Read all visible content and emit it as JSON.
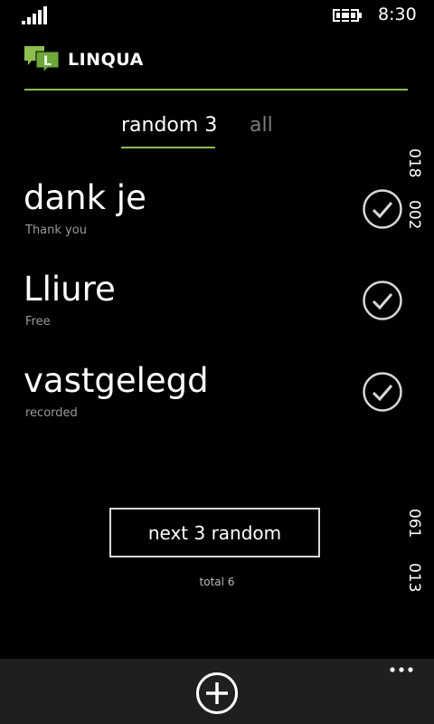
{
  "status": {
    "time": "8:30"
  },
  "app": {
    "title": "LINQUA",
    "logo_letter": "L"
  },
  "tabs": [
    {
      "label": "random 3",
      "selected": true
    },
    {
      "label": "all",
      "selected": false
    }
  ],
  "side_numbers": [
    "018",
    "002",
    "061",
    "013"
  ],
  "words": [
    {
      "word": "dank je",
      "translation": "Thank you",
      "checked": true
    },
    {
      "word": "Lliure",
      "translation": "Free",
      "checked": true
    },
    {
      "word": "vastgelegd",
      "translation": "recorded",
      "checked": true
    }
  ],
  "next_button": {
    "label": "next 3 random"
  },
  "total": "total 6",
  "colors": {
    "accent": "#8cbf4e",
    "background": "#000000",
    "app_bar": "#1f1f1f"
  },
  "icons": {
    "add": "add-icon",
    "more": "more-icon",
    "check": "check-circle-icon"
  }
}
